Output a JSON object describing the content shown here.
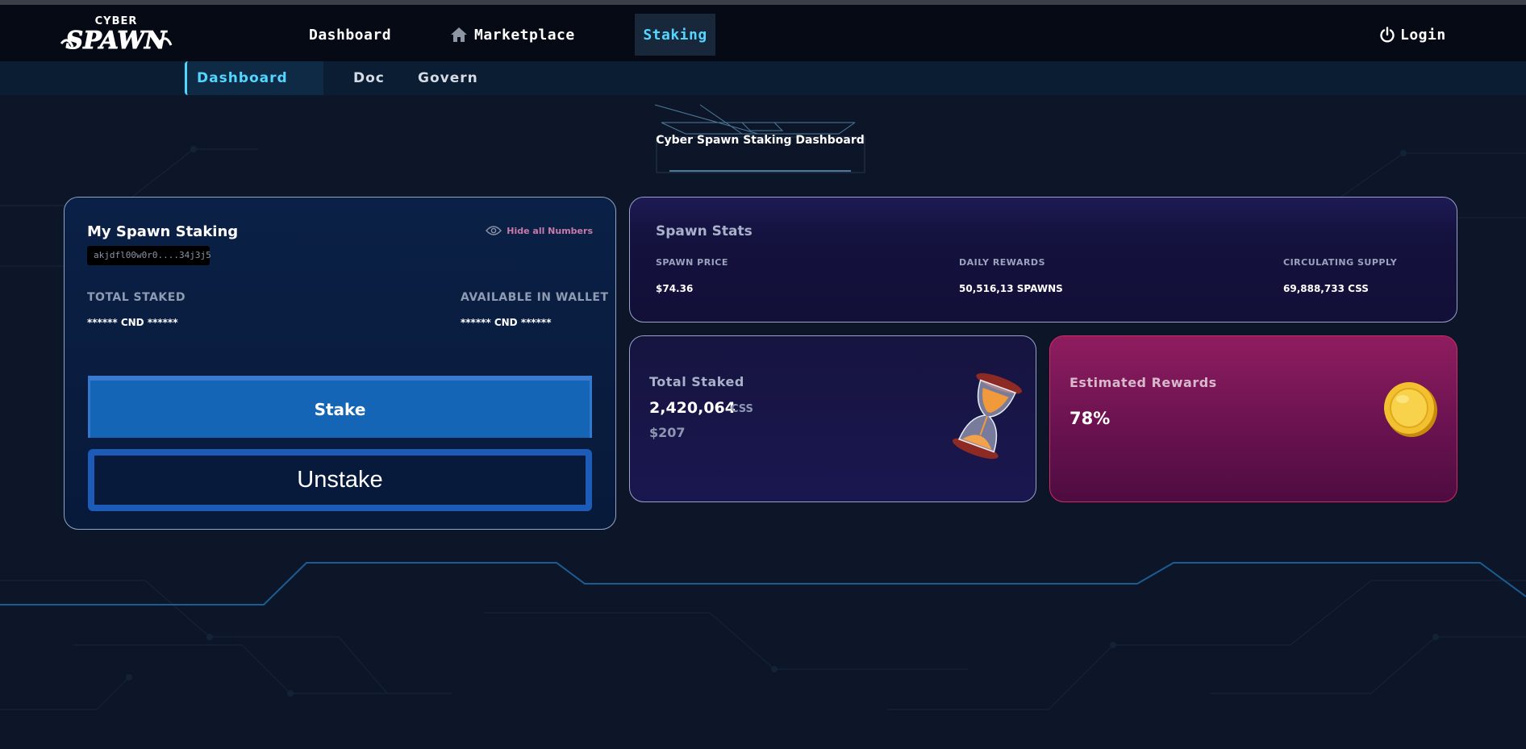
{
  "nav": {
    "logo_text": "CYBER SPAWN",
    "dashboard": "Dashboard",
    "marketplace": "Marketplace",
    "staking": "Staking",
    "login": "Login"
  },
  "subnav": {
    "dashboard": "Dashboard",
    "doc": "Doc",
    "govern": "Govern"
  },
  "page_title": "Cyber Spawn Staking Dashboard",
  "my_staking": {
    "title": "My Spawn Staking",
    "address": "akjdfl00w0r0....34j3j5",
    "hide_label": "Hide all Numbers",
    "total_staked_label": "TOTAL STAKED",
    "total_staked_value": "****** CND ******",
    "available_label": "AVAILABLE IN WALLET",
    "available_value": "****** CND ******",
    "stake_label": "Stake",
    "unstake_label": "Unstake"
  },
  "spawn_stats": {
    "title": "Spawn Stats",
    "price_label": "SPAWN PRICE",
    "price_value": "$74.36",
    "daily_label": "DAILY REWARDS",
    "daily_value": "50,516,13 SPAWNS",
    "supply_label": "CIRCULATING SUPPLY",
    "supply_value": "69,888,733 CSS"
  },
  "total_staked_card": {
    "title": "Total Staked",
    "value": "2,420,064",
    "unit": "CSS",
    "usd": "$207"
  },
  "estimated_rewards": {
    "title": "Estimated Rewards",
    "value": "78%"
  },
  "colors": {
    "accent": "#52d6ff",
    "background": "#0d1628",
    "stake_button": "#1565b6",
    "rewards_card": "#7a1758"
  },
  "icons": {
    "home": "home-icon",
    "power": "power-icon",
    "eye": "eye-icon",
    "hourglass": "hourglass-icon",
    "coin": "coin-icon"
  }
}
